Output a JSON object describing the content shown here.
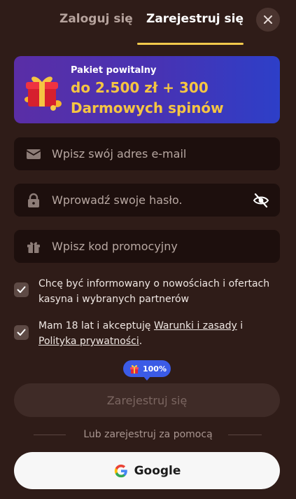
{
  "header": {
    "tabs": [
      {
        "label": "Zaloguj się",
        "active": false
      },
      {
        "label": "Zarejestruj się",
        "active": true
      }
    ],
    "close_icon": "close-icon"
  },
  "banner": {
    "kicker": "Pakiet powitalny",
    "line1": "do 2.500 zł + 300",
    "line2": "Darmowych spinów",
    "icon": "gift-icon"
  },
  "form": {
    "email": {
      "placeholder": "Wpisz swój adres e-mail",
      "value": "",
      "icon": "envelope-icon"
    },
    "password": {
      "placeholder": "Wprowadź swoje hasło.",
      "value": "",
      "icon": "lock-icon",
      "toggle_icon": "eye-off-icon"
    },
    "promo": {
      "placeholder": "Wpisz kod promocyjny",
      "value": "",
      "icon": "gift-icon"
    }
  },
  "consents": {
    "news": {
      "checked": true,
      "text": "Chcę być informowany o nowościach i ofertach kasyna i wybranych partnerów"
    },
    "age": {
      "checked": true,
      "text_before": "Mam 18 lat i akceptuję ",
      "terms_link": "Warunki i zasady",
      "text_middle": " i ",
      "privacy_link": "Polityka prywatności",
      "text_after": "."
    }
  },
  "progress_badge": {
    "text": "100%",
    "value_percent": 100,
    "icon": "gift-icon"
  },
  "submit": {
    "label": "Zarejestruj się"
  },
  "divider": {
    "text": "Lub zarejestruj za pomocą"
  },
  "social": {
    "google_label": "Google",
    "icon": "google-icon"
  },
  "colors": {
    "background": "#2f1c18",
    "field": "#1d0f0d",
    "accent_gold": "#f5c542",
    "tab_underline": "#f2c94c",
    "badge_blue": "#3b5be6"
  }
}
